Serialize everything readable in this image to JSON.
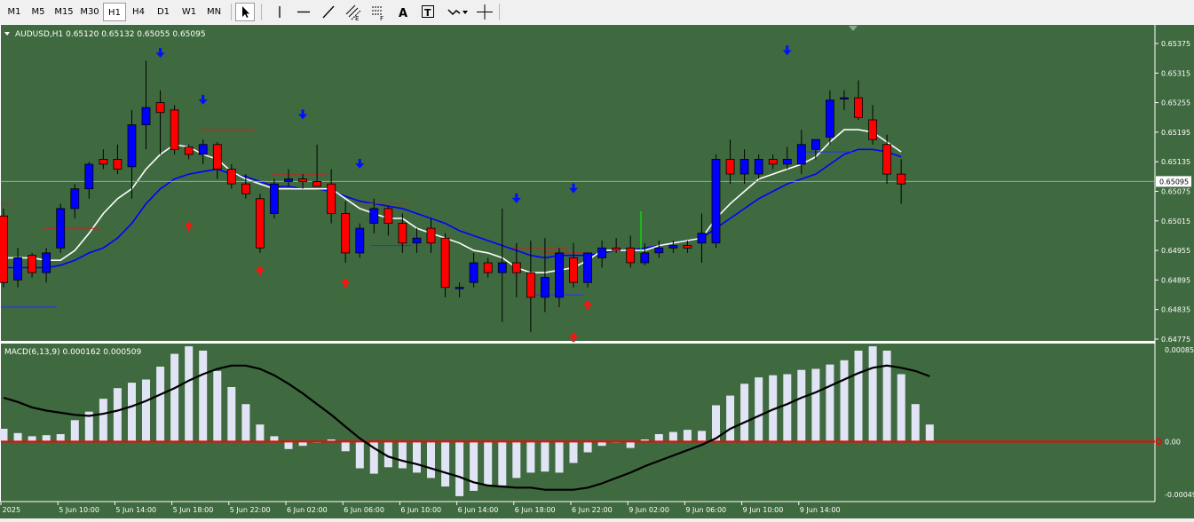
{
  "toolbar": {
    "timeframes": [
      "M1",
      "M5",
      "M15",
      "M30",
      "H1",
      "H4",
      "D1",
      "W1",
      "MN"
    ],
    "active_timeframe": "H1",
    "tools": [
      "cursor-icon",
      "vertical-line-icon",
      "horizontal-line-icon",
      "trendline-icon",
      "equidistant-channel-icon",
      "fibonacci-icon",
      "text-label-icon",
      "text-box-icon",
      "arrows-icon",
      "crosshair-icon"
    ]
  },
  "main_chart": {
    "symbol_header": "AUDUSD,H1  0.65120 0.65132 0.65055 0.65095",
    "price_labels": [
      "0.65375",
      "0.65315",
      "0.65255",
      "0.65195",
      "0.65135",
      "0.65075",
      "0.65015",
      "0.64955",
      "0.64895",
      "0.64835",
      "0.64775"
    ],
    "current_price": "0.65095",
    "current_price_value": 0.65095
  },
  "macd": {
    "header": "MACD(6,13,9) 0.000162 0.000509",
    "levels": [
      "0.000858",
      "0.00",
      "-0.000494"
    ],
    "histogram": [
      0.00012,
      8e-05,
      5e-05,
      6e-05,
      7e-05,
      0.0002,
      0.00028,
      0.0004,
      0.0005,
      0.00055,
      0.00058,
      0.0007,
      0.00082,
      0.00089,
      0.00085,
      0.00066,
      0.00051,
      0.00035,
      0.00016,
      5e-05,
      -7e-05,
      -4e-05,
      -1e-05,
      2e-05,
      -9e-05,
      -0.00025,
      -0.0003,
      -0.00024,
      -0.00025,
      -0.00029,
      -0.00034,
      -0.00042,
      -0.00051,
      -0.00046,
      -0.00041,
      -0.00041,
      -0.00034,
      -0.00029,
      -0.00028,
      -0.00029,
      -0.0002,
      -0.0001,
      -4e-05,
      -1e-05,
      -6e-05,
      2e-05,
      7e-05,
      9e-05,
      0.00011,
      0.0001,
      0.00034,
      0.00043,
      0.00054,
      0.0006,
      0.00062,
      0.00063,
      0.00067,
      0.00068,
      0.00072,
      0.00076,
      0.00085,
      0.00089,
      0.00085,
      0.00063,
      0.00035,
      0.00016
    ],
    "signal": [
      0.00041,
      0.00037,
      0.00032,
      0.00029,
      0.00027,
      0.00025,
      0.00024,
      0.00026,
      0.00029,
      0.00033,
      0.00038,
      0.00044,
      0.0005,
      0.00057,
      0.00063,
      0.00068,
      0.00071,
      0.00071,
      0.00068,
      0.00062,
      0.00054,
      0.00045,
      0.00035,
      0.00025,
      0.00014,
      3e-05,
      -6e-05,
      -0.00014,
      -0.00018,
      -0.00021,
      -0.00025,
      -0.00029,
      -0.00033,
      -0.00038,
      -0.00041,
      -0.00042,
      -0.00043,
      -0.00043,
      -0.00045,
      -0.00045,
      -0.00045,
      -0.00043,
      -0.00039,
      -0.00034,
      -0.00029,
      -0.00023,
      -0.00018,
      -0.00013,
      -8e-05,
      -3e-05,
      3e-05,
      0.00012,
      0.00018,
      0.00024,
      0.0003,
      0.00035,
      0.00041,
      0.00046,
      0.00052,
      0.00058,
      0.00064,
      0.00069,
      0.00071,
      0.00069,
      0.00066,
      0.00061
    ]
  },
  "time_axis": [
    "5 Jun 2025",
    "5 Jun 10:00",
    "5 Jun 14:00",
    "5 Jun 18:00",
    "5 Jun 22:00",
    "6 Jun 02:00",
    "6 Jun 06:00",
    "6 Jun 10:00",
    "6 Jun 14:00",
    "6 Jun 18:00",
    "6 Jun 22:00",
    "9 Jun 02:00",
    "9 Jun 06:00",
    "9 Jun 10:00",
    "9 Jun 14:00"
  ],
  "colors": {
    "background": "#3f6a3f",
    "bull": "#0000ff",
    "bear": "#ff0000",
    "wick": "#000000",
    "fast_ma": "#ffffff",
    "slow_ma": "#0000ff",
    "macd_hist": "#e0e4f4",
    "macd_signal": "#000000",
    "zero_line": "#ff0000",
    "grid": "#ffffff"
  },
  "chart_data": {
    "type": "candlestick",
    "candles": [
      {
        "o": 0.65025,
        "h": 0.6504,
        "l": 0.6488,
        "c": 0.6489
      },
      {
        "o": 0.64895,
        "h": 0.6496,
        "l": 0.6488,
        "c": 0.6494
      },
      {
        "o": 0.64945,
        "h": 0.6495,
        "l": 0.649,
        "c": 0.6491
      },
      {
        "o": 0.6491,
        "h": 0.6496,
        "l": 0.6489,
        "c": 0.6495
      },
      {
        "o": 0.6496,
        "h": 0.6505,
        "l": 0.6495,
        "c": 0.6504
      },
      {
        "o": 0.6504,
        "h": 0.6509,
        "l": 0.6502,
        "c": 0.6508
      },
      {
        "o": 0.6508,
        "h": 0.65135,
        "l": 0.6506,
        "c": 0.6513
      },
      {
        "o": 0.6514,
        "h": 0.6516,
        "l": 0.6512,
        "c": 0.6513
      },
      {
        "o": 0.6514,
        "h": 0.6517,
        "l": 0.6511,
        "c": 0.6512
      },
      {
        "o": 0.65125,
        "h": 0.6524,
        "l": 0.6506,
        "c": 0.6521
      },
      {
        "o": 0.6521,
        "h": 0.6534,
        "l": 0.6516,
        "c": 0.65245
      },
      {
        "o": 0.65255,
        "h": 0.6528,
        "l": 0.6515,
        "c": 0.65235
      },
      {
        "o": 0.6524,
        "h": 0.6525,
        "l": 0.6515,
        "c": 0.6516
      },
      {
        "o": 0.65165,
        "h": 0.6517,
        "l": 0.6514,
        "c": 0.6515
      },
      {
        "o": 0.6515,
        "h": 0.6518,
        "l": 0.6513,
        "c": 0.6517
      },
      {
        "o": 0.6517,
        "h": 0.65175,
        "l": 0.651,
        "c": 0.6512
      },
      {
        "o": 0.6512,
        "h": 0.6513,
        "l": 0.6508,
        "c": 0.6509
      },
      {
        "o": 0.6509,
        "h": 0.6511,
        "l": 0.6506,
        "c": 0.6507
      },
      {
        "o": 0.6506,
        "h": 0.6507,
        "l": 0.6495,
        "c": 0.6496
      },
      {
        "o": 0.6503,
        "h": 0.651,
        "l": 0.6502,
        "c": 0.6509
      },
      {
        "o": 0.65095,
        "h": 0.6512,
        "l": 0.65085,
        "c": 0.651
      },
      {
        "o": 0.651,
        "h": 0.6511,
        "l": 0.6508,
        "c": 0.65095
      },
      {
        "o": 0.65095,
        "h": 0.6517,
        "l": 0.6509,
        "c": 0.65085
      },
      {
        "o": 0.6509,
        "h": 0.6512,
        "l": 0.6501,
        "c": 0.6503
      },
      {
        "o": 0.6503,
        "h": 0.65055,
        "l": 0.6493,
        "c": 0.6495
      },
      {
        "o": 0.6495,
        "h": 0.6501,
        "l": 0.6494,
        "c": 0.65
      },
      {
        "o": 0.6501,
        "h": 0.6506,
        "l": 0.6499,
        "c": 0.6504
      },
      {
        "o": 0.6504,
        "h": 0.65045,
        "l": 0.64985,
        "c": 0.6501
      },
      {
        "o": 0.6501,
        "h": 0.6503,
        "l": 0.6495,
        "c": 0.6497
      },
      {
        "o": 0.6497,
        "h": 0.65,
        "l": 0.6495,
        "c": 0.6498
      },
      {
        "o": 0.65,
        "h": 0.6502,
        "l": 0.6495,
        "c": 0.6497
      },
      {
        "o": 0.6498,
        "h": 0.6499,
        "l": 0.6486,
        "c": 0.6488
      },
      {
        "o": 0.6488,
        "h": 0.6489,
        "l": 0.6486,
        "c": 0.6488
      },
      {
        "o": 0.6489,
        "h": 0.6495,
        "l": 0.6488,
        "c": 0.6493
      },
      {
        "o": 0.6493,
        "h": 0.6494,
        "l": 0.649,
        "c": 0.6491
      },
      {
        "o": 0.6491,
        "h": 0.6504,
        "l": 0.6481,
        "c": 0.6493
      },
      {
        "o": 0.6493,
        "h": 0.6497,
        "l": 0.6486,
        "c": 0.6491
      },
      {
        "o": 0.6491,
        "h": 0.64975,
        "l": 0.6479,
        "c": 0.6486
      },
      {
        "o": 0.6486,
        "h": 0.6498,
        "l": 0.6483,
        "c": 0.649
      },
      {
        "o": 0.6486,
        "h": 0.6496,
        "l": 0.6484,
        "c": 0.6495
      },
      {
        "o": 0.6494,
        "h": 0.6497,
        "l": 0.6488,
        "c": 0.6489
      },
      {
        "o": 0.6489,
        "h": 0.6495,
        "l": 0.6488,
        "c": 0.6495
      },
      {
        "o": 0.6494,
        "h": 0.64975,
        "l": 0.6492,
        "c": 0.6496
      },
      {
        "o": 0.6496,
        "h": 0.6498,
        "l": 0.6495,
        "c": 0.64955
      },
      {
        "o": 0.6496,
        "h": 0.64985,
        "l": 0.6492,
        "c": 0.6493
      },
      {
        "o": 0.6493,
        "h": 0.6497,
        "l": 0.64925,
        "c": 0.6495
      },
      {
        "o": 0.6495,
        "h": 0.64975,
        "l": 0.6494,
        "c": 0.6496
      },
      {
        "o": 0.6496,
        "h": 0.64975,
        "l": 0.6495,
        "c": 0.64965
      },
      {
        "o": 0.64965,
        "h": 0.64975,
        "l": 0.6495,
        "c": 0.6496
      },
      {
        "o": 0.6497,
        "h": 0.6503,
        "l": 0.6493,
        "c": 0.6499
      },
      {
        "o": 0.6497,
        "h": 0.6515,
        "l": 0.6496,
        "c": 0.6514
      },
      {
        "o": 0.6514,
        "h": 0.6518,
        "l": 0.6509,
        "c": 0.6511
      },
      {
        "o": 0.6511,
        "h": 0.6516,
        "l": 0.6509,
        "c": 0.6514
      },
      {
        "o": 0.6511,
        "h": 0.6515,
        "l": 0.651,
        "c": 0.6514
      },
      {
        "o": 0.6514,
        "h": 0.6515,
        "l": 0.6512,
        "c": 0.6513
      },
      {
        "o": 0.6513,
        "h": 0.65165,
        "l": 0.6512,
        "c": 0.6514
      },
      {
        "o": 0.6513,
        "h": 0.652,
        "l": 0.6511,
        "c": 0.6517
      },
      {
        "o": 0.6516,
        "h": 0.6518,
        "l": 0.6514,
        "c": 0.6518
      },
      {
        "o": 0.65185,
        "h": 0.6528,
        "l": 0.6517,
        "c": 0.6526
      },
      {
        "o": 0.65265,
        "h": 0.6528,
        "l": 0.6524,
        "c": 0.65265
      },
      {
        "o": 0.65265,
        "h": 0.653,
        "l": 0.6522,
        "c": 0.65225
      },
      {
        "o": 0.6522,
        "h": 0.6525,
        "l": 0.6517,
        "c": 0.6518
      },
      {
        "o": 0.6517,
        "h": 0.6519,
        "l": 0.6509,
        "c": 0.6511
      },
      {
        "o": 0.6511,
        "h": 0.6514,
        "l": 0.6505,
        "c": 0.6509
      }
    ],
    "fast_ma": [
      0.6494,
      0.6494,
      0.6494,
      0.64935,
      0.64935,
      0.64955,
      0.6499,
      0.6503,
      0.6506,
      0.6508,
      0.6512,
      0.6515,
      0.6517,
      0.65165,
      0.6515,
      0.6514,
      0.65115,
      0.651,
      0.6509,
      0.6508,
      0.6508,
      0.6508,
      0.6508,
      0.6508,
      0.6506,
      0.6504,
      0.6503,
      0.6502,
      0.6502,
      0.65,
      0.6499,
      0.6498,
      0.6497,
      0.64955,
      0.6495,
      0.6494,
      0.6492,
      0.6491,
      0.6491,
      0.64915,
      0.6492,
      0.64935,
      0.64955,
      0.64955,
      0.64955,
      0.64955,
      0.64965,
      0.6497,
      0.64975,
      0.6498,
      0.6502,
      0.6505,
      0.65075,
      0.651,
      0.6511,
      0.6512,
      0.6513,
      0.65145,
      0.65175,
      0.652,
      0.652,
      0.65195,
      0.65175,
      0.65155
    ],
    "slow_ma": [
      0.6492,
      0.6492,
      0.6492,
      0.6492,
      0.64925,
      0.64935,
      0.6495,
      0.6496,
      0.6498,
      0.6501,
      0.6505,
      0.6508,
      0.651,
      0.6511,
      0.65115,
      0.6512,
      0.6511,
      0.65105,
      0.65095,
      0.65085,
      0.65085,
      0.6508,
      0.6508,
      0.65075,
      0.65065,
      0.65055,
      0.6505,
      0.65045,
      0.6504,
      0.6503,
      0.6502,
      0.6501,
      0.64995,
      0.64985,
      0.64975,
      0.64965,
      0.64955,
      0.64945,
      0.6494,
      0.64945,
      0.64945,
      0.64945,
      0.6495,
      0.64955,
      0.64955,
      0.6496,
      0.64965,
      0.6497,
      0.64975,
      0.6498,
      0.65,
      0.6502,
      0.6504,
      0.6506,
      0.65075,
      0.6509,
      0.651,
      0.6511,
      0.6513,
      0.6515,
      0.6516,
      0.6516,
      0.65155,
      0.65145
    ],
    "up_arrows": [
      {
        "i": 13,
        "y": 0.65005
      },
      {
        "i": 18,
        "y": 0.64915
      },
      {
        "i": 24,
        "y": 0.6489
      },
      {
        "i": 40,
        "y": 0.6478
      },
      {
        "i": 41,
        "y": 0.64845
      }
    ],
    "down_arrows": [
      {
        "i": 11,
        "y": 0.65355
      },
      {
        "i": 14,
        "y": 0.6526
      },
      {
        "i": 21,
        "y": 0.6523
      },
      {
        "i": 25,
        "y": 0.6513
      },
      {
        "i": 36,
        "y": 0.6506
      },
      {
        "i": 40,
        "y": 0.6508
      },
      {
        "i": 55,
        "y": 0.6536
      }
    ]
  }
}
